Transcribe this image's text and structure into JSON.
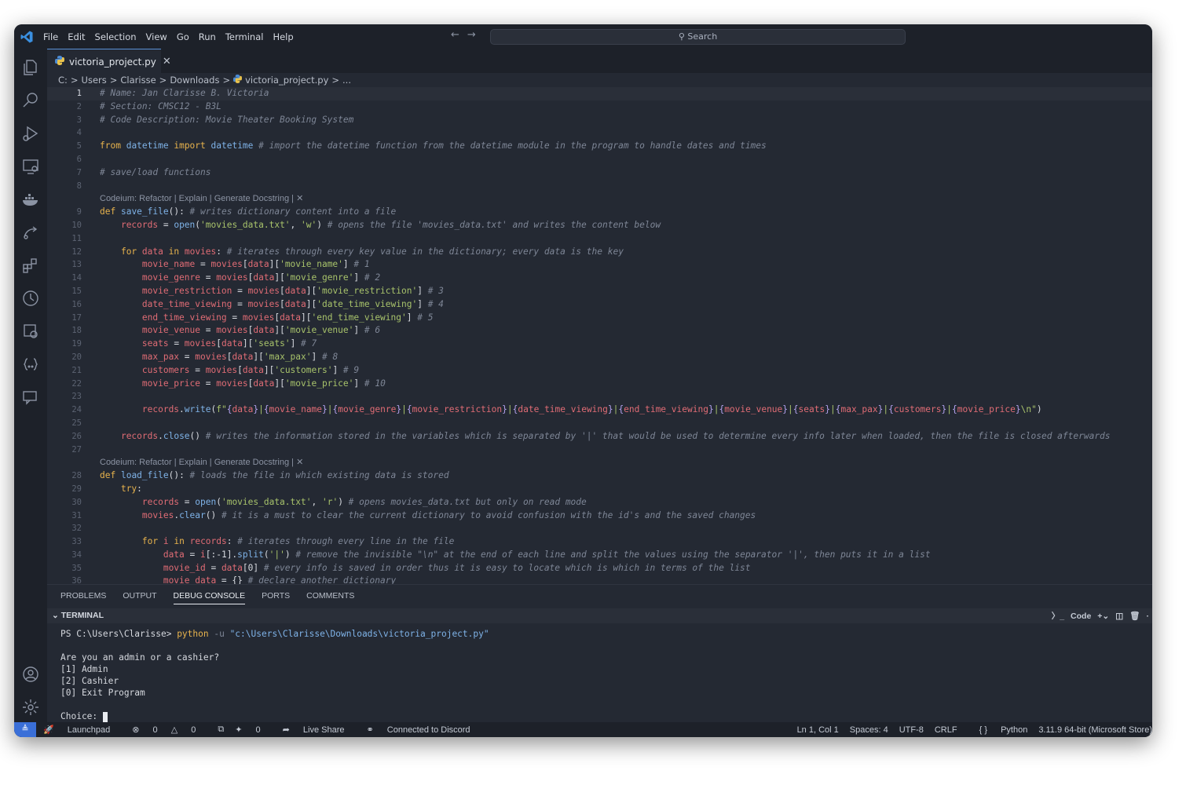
{
  "titlebar": {
    "menu": [
      "File",
      "Edit",
      "Selection",
      "View",
      "Go",
      "Run",
      "Terminal",
      "Help"
    ],
    "search_label": "Search"
  },
  "tab": {
    "filename": "victoria_project.py"
  },
  "breadcrumb": [
    "C:",
    "Users",
    "Clarisse",
    "Downloads",
    "victoria_project.py",
    "..."
  ],
  "codelens": "Codeium: Refactor | Explain | Generate Docstring | ✕",
  "code_lines": [
    {
      "n": "1",
      "segs": [
        [
          "c",
          "# Name: Jan Clarisse B. Victoria"
        ]
      ]
    },
    {
      "n": "2",
      "segs": [
        [
          "c",
          "# Section: CMSC12 - B3L"
        ]
      ]
    },
    {
      "n": "3",
      "segs": [
        [
          "c",
          "# Code Description: Movie Theater Booking System"
        ]
      ]
    },
    {
      "n": "4",
      "segs": []
    },
    {
      "n": "5",
      "segs": [
        [
          "k",
          "from"
        ],
        [
          "p",
          " "
        ],
        [
          "f",
          "datetime"
        ],
        [
          "p",
          " "
        ],
        [
          "k",
          "import"
        ],
        [
          "p",
          " "
        ],
        [
          "f",
          "datetime"
        ],
        [
          "p",
          " "
        ],
        [
          "c",
          "# import the datetime function from the datetime module in the program to handle dates and times"
        ]
      ]
    },
    {
      "n": "6",
      "segs": []
    },
    {
      "n": "7",
      "segs": [
        [
          "c",
          "# save/load functions"
        ]
      ]
    },
    {
      "n": "8",
      "segs": []
    },
    {
      "lens": true
    },
    {
      "n": "9",
      "segs": [
        [
          "k",
          "def"
        ],
        [
          "p",
          " "
        ],
        [
          "f",
          "save_file"
        ],
        [
          "p",
          "(): "
        ],
        [
          "c",
          "# writes dictionary content into a file"
        ]
      ]
    },
    {
      "n": "10",
      "segs": [
        [
          "p",
          "    "
        ],
        [
          "v",
          "records"
        ],
        [
          "p",
          " = "
        ],
        [
          "f",
          "open"
        ],
        [
          "p",
          "("
        ],
        [
          "s",
          "'movies_data.txt'"
        ],
        [
          "p",
          ", "
        ],
        [
          "s",
          "'w'"
        ],
        [
          "p",
          ") "
        ],
        [
          "c",
          "# opens the file 'movies_data.txt' and writes the content below"
        ]
      ]
    },
    {
      "n": "11",
      "segs": []
    },
    {
      "n": "12",
      "segs": [
        [
          "p",
          "    "
        ],
        [
          "k",
          "for"
        ],
        [
          "p",
          " "
        ],
        [
          "v",
          "data"
        ],
        [
          "p",
          " "
        ],
        [
          "k",
          "in"
        ],
        [
          "p",
          " "
        ],
        [
          "v",
          "movies"
        ],
        [
          "p",
          ": "
        ],
        [
          "c",
          "# iterates through every key value in the dictionary; every data is the key"
        ]
      ]
    },
    {
      "n": "13",
      "segs": [
        [
          "p",
          "        "
        ],
        [
          "v",
          "movie_name"
        ],
        [
          "p",
          " = "
        ],
        [
          "v",
          "movies"
        ],
        [
          "p",
          "["
        ],
        [
          "v",
          "data"
        ],
        [
          "p",
          "]["
        ],
        [
          "s",
          "'movie_name'"
        ],
        [
          "p",
          "] "
        ],
        [
          "c",
          "# 1"
        ]
      ]
    },
    {
      "n": "14",
      "segs": [
        [
          "p",
          "        "
        ],
        [
          "v",
          "movie_genre"
        ],
        [
          "p",
          " = "
        ],
        [
          "v",
          "movies"
        ],
        [
          "p",
          "["
        ],
        [
          "v",
          "data"
        ],
        [
          "p",
          "]["
        ],
        [
          "s",
          "'movie_genre'"
        ],
        [
          "p",
          "] "
        ],
        [
          "c",
          "# 2"
        ]
      ]
    },
    {
      "n": "15",
      "segs": [
        [
          "p",
          "        "
        ],
        [
          "v",
          "movie_restriction"
        ],
        [
          "p",
          " = "
        ],
        [
          "v",
          "movies"
        ],
        [
          "p",
          "["
        ],
        [
          "v",
          "data"
        ],
        [
          "p",
          "]["
        ],
        [
          "s",
          "'movie_restriction'"
        ],
        [
          "p",
          "] "
        ],
        [
          "c",
          "# 3"
        ]
      ]
    },
    {
      "n": "16",
      "segs": [
        [
          "p",
          "        "
        ],
        [
          "v",
          "date_time_viewing"
        ],
        [
          "p",
          " = "
        ],
        [
          "v",
          "movies"
        ],
        [
          "p",
          "["
        ],
        [
          "v",
          "data"
        ],
        [
          "p",
          "]["
        ],
        [
          "s",
          "'date_time_viewing'"
        ],
        [
          "p",
          "] "
        ],
        [
          "c",
          "# 4"
        ]
      ]
    },
    {
      "n": "17",
      "segs": [
        [
          "p",
          "        "
        ],
        [
          "v",
          "end_time_viewing"
        ],
        [
          "p",
          " = "
        ],
        [
          "v",
          "movies"
        ],
        [
          "p",
          "["
        ],
        [
          "v",
          "data"
        ],
        [
          "p",
          "]["
        ],
        [
          "s",
          "'end_time_viewing'"
        ],
        [
          "p",
          "] "
        ],
        [
          "c",
          "# 5"
        ]
      ]
    },
    {
      "n": "18",
      "segs": [
        [
          "p",
          "        "
        ],
        [
          "v",
          "movie_venue"
        ],
        [
          "p",
          " = "
        ],
        [
          "v",
          "movies"
        ],
        [
          "p",
          "["
        ],
        [
          "v",
          "data"
        ],
        [
          "p",
          "]["
        ],
        [
          "s",
          "'movie_venue'"
        ],
        [
          "p",
          "] "
        ],
        [
          "c",
          "# 6"
        ]
      ]
    },
    {
      "n": "19",
      "segs": [
        [
          "p",
          "        "
        ],
        [
          "v",
          "seats"
        ],
        [
          "p",
          " = "
        ],
        [
          "v",
          "movies"
        ],
        [
          "p",
          "["
        ],
        [
          "v",
          "data"
        ],
        [
          "p",
          "]["
        ],
        [
          "s",
          "'seats'"
        ],
        [
          "p",
          "] "
        ],
        [
          "c",
          "# 7"
        ]
      ]
    },
    {
      "n": "20",
      "segs": [
        [
          "p",
          "        "
        ],
        [
          "v",
          "max_pax"
        ],
        [
          "p",
          " = "
        ],
        [
          "v",
          "movies"
        ],
        [
          "p",
          "["
        ],
        [
          "v",
          "data"
        ],
        [
          "p",
          "]["
        ],
        [
          "s",
          "'max_pax'"
        ],
        [
          "p",
          "] "
        ],
        [
          "c",
          "# 8"
        ]
      ]
    },
    {
      "n": "21",
      "segs": [
        [
          "p",
          "        "
        ],
        [
          "v",
          "customers"
        ],
        [
          "p",
          " = "
        ],
        [
          "v",
          "movies"
        ],
        [
          "p",
          "["
        ],
        [
          "v",
          "data"
        ],
        [
          "p",
          "]["
        ],
        [
          "s",
          "'customers'"
        ],
        [
          "p",
          "] "
        ],
        [
          "c",
          "# 9"
        ]
      ]
    },
    {
      "n": "22",
      "segs": [
        [
          "p",
          "        "
        ],
        [
          "v",
          "movie_price"
        ],
        [
          "p",
          " = "
        ],
        [
          "v",
          "movies"
        ],
        [
          "p",
          "["
        ],
        [
          "v",
          "data"
        ],
        [
          "p",
          "]["
        ],
        [
          "s",
          "'movie_price'"
        ],
        [
          "p",
          "] "
        ],
        [
          "c",
          "# 10"
        ]
      ]
    },
    {
      "n": "23",
      "segs": []
    },
    {
      "n": "24",
      "segs": [
        [
          "p",
          "        "
        ],
        [
          "v",
          "records"
        ],
        [
          "p",
          "."
        ],
        [
          "f",
          "write"
        ],
        [
          "p",
          "("
        ],
        [
          "s",
          "f\""
        ],
        [
          "d",
          "{"
        ],
        [
          "v",
          "data"
        ],
        [
          "d",
          "}"
        ],
        [
          "s",
          "|"
        ],
        [
          "d",
          "{"
        ],
        [
          "v",
          "movie_name"
        ],
        [
          "d",
          "}"
        ],
        [
          "s",
          "|"
        ],
        [
          "d",
          "{"
        ],
        [
          "v",
          "movie_genre"
        ],
        [
          "d",
          "}"
        ],
        [
          "s",
          "|"
        ],
        [
          "d",
          "{"
        ],
        [
          "v",
          "movie_restriction"
        ],
        [
          "d",
          "}"
        ],
        [
          "s",
          "|"
        ],
        [
          "d",
          "{"
        ],
        [
          "v",
          "date_time_viewing"
        ],
        [
          "d",
          "}"
        ],
        [
          "s",
          "|"
        ],
        [
          "d",
          "{"
        ],
        [
          "v",
          "end_time_viewing"
        ],
        [
          "d",
          "}"
        ],
        [
          "s",
          "|"
        ],
        [
          "d",
          "{"
        ],
        [
          "v",
          "movie_venue"
        ],
        [
          "d",
          "}"
        ],
        [
          "s",
          "|"
        ],
        [
          "d",
          "{"
        ],
        [
          "v",
          "seats"
        ],
        [
          "d",
          "}"
        ],
        [
          "s",
          "|"
        ],
        [
          "d",
          "{"
        ],
        [
          "v",
          "max_pax"
        ],
        [
          "d",
          "}"
        ],
        [
          "s",
          "|"
        ],
        [
          "d",
          "{"
        ],
        [
          "v",
          "customers"
        ],
        [
          "d",
          "}"
        ],
        [
          "s",
          "|"
        ],
        [
          "d",
          "{"
        ],
        [
          "v",
          "movie_price"
        ],
        [
          "d",
          "}"
        ],
        [
          "s",
          "\\n\""
        ],
        [
          "p",
          ")"
        ]
      ]
    },
    {
      "n": "25",
      "segs": []
    },
    {
      "n": "26",
      "segs": [
        [
          "p",
          "    "
        ],
        [
          "v",
          "records"
        ],
        [
          "p",
          "."
        ],
        [
          "f",
          "close"
        ],
        [
          "p",
          "() "
        ],
        [
          "c",
          "# writes the information stored in the variables which is separated by '|' that would be used to determine every info later when loaded, then the file is closed afterwards"
        ]
      ]
    },
    {
      "n": "27",
      "segs": []
    },
    {
      "lens": true
    },
    {
      "n": "28",
      "segs": [
        [
          "k",
          "def"
        ],
        [
          "p",
          " "
        ],
        [
          "f",
          "load_file"
        ],
        [
          "p",
          "(): "
        ],
        [
          "c",
          "# loads the file in which existing data is stored"
        ]
      ]
    },
    {
      "n": "29",
      "segs": [
        [
          "p",
          "    "
        ],
        [
          "k",
          "try"
        ],
        [
          "p",
          ":"
        ]
      ]
    },
    {
      "n": "30",
      "segs": [
        [
          "p",
          "        "
        ],
        [
          "v",
          "records"
        ],
        [
          "p",
          " = "
        ],
        [
          "f",
          "open"
        ],
        [
          "p",
          "("
        ],
        [
          "s",
          "'movies_data.txt'"
        ],
        [
          "p",
          ", "
        ],
        [
          "s",
          "'r'"
        ],
        [
          "p",
          ") "
        ],
        [
          "c",
          "# opens movies_data.txt but only on read mode"
        ]
      ]
    },
    {
      "n": "31",
      "segs": [
        [
          "p",
          "        "
        ],
        [
          "v",
          "movies"
        ],
        [
          "p",
          "."
        ],
        [
          "f",
          "clear"
        ],
        [
          "p",
          "() "
        ],
        [
          "c",
          "# it is a must to clear the current dictionary to avoid confusion with the id's and the saved changes"
        ]
      ]
    },
    {
      "n": "32",
      "segs": []
    },
    {
      "n": "33",
      "segs": [
        [
          "p",
          "        "
        ],
        [
          "k",
          "for"
        ],
        [
          "p",
          " "
        ],
        [
          "v",
          "i"
        ],
        [
          "p",
          " "
        ],
        [
          "k",
          "in"
        ],
        [
          "p",
          " "
        ],
        [
          "v",
          "records"
        ],
        [
          "p",
          ": "
        ],
        [
          "c",
          "# iterates through every line in the file"
        ]
      ]
    },
    {
      "n": "34",
      "segs": [
        [
          "p",
          "            "
        ],
        [
          "v",
          "data"
        ],
        [
          "p",
          " = "
        ],
        [
          "v",
          "i"
        ],
        [
          "p",
          "[:-1]."
        ],
        [
          "f",
          "split"
        ],
        [
          "p",
          "("
        ],
        [
          "s",
          "'|'"
        ],
        [
          "p",
          ") "
        ],
        [
          "c",
          "# remove the invisible \"\\n\" at the end of each line and split the values using the separator '|', then puts it in a list"
        ]
      ]
    },
    {
      "n": "35",
      "segs": [
        [
          "p",
          "            "
        ],
        [
          "v",
          "movie_id"
        ],
        [
          "p",
          " = "
        ],
        [
          "v",
          "data"
        ],
        [
          "p",
          "[0] "
        ],
        [
          "c",
          "# every info is saved in order thus it is easy to locate which is which in terms of the list"
        ]
      ]
    },
    {
      "n": "36",
      "segs": [
        [
          "p",
          "            "
        ],
        [
          "v",
          "movie_data"
        ],
        [
          "p",
          " = {} "
        ],
        [
          "c",
          "# declare another dictionary"
        ]
      ]
    }
  ],
  "panel_tabs": [
    "PROBLEMS",
    "OUTPUT",
    "DEBUG CONSOLE",
    "PORTS",
    "COMMENTS"
  ],
  "terminal": {
    "title": "TERMINAL",
    "shell_label": "Code",
    "prompt": "PS C:\\Users\\Clarisse> ",
    "cmd": "python",
    "arg": " -u ",
    "path": "\"c:\\Users\\Clarisse\\Downloads\\victoria_project.py\"",
    "lines": [
      "",
      "Are you an admin or a cashier?",
      "[1] Admin",
      "[2] Cashier",
      "[0] Exit Program",
      ""
    ],
    "choice": "Choice: "
  },
  "statusbar": {
    "launchpad": "Launchpad",
    "errors": "0",
    "warnings": "0",
    "ports": "0",
    "live_share": "Live Share",
    "discord": "Connected to Discord",
    "position": "Ln 1, Col 1",
    "spaces": "Spaces: 4",
    "encoding": "UTF-8",
    "eol": "CRLF",
    "language": "Python",
    "interpreter": "3.11.9 64-bit (Microsoft Store)"
  },
  "colors": {
    "accent": "#3a6fd8",
    "background": "#242933"
  }
}
